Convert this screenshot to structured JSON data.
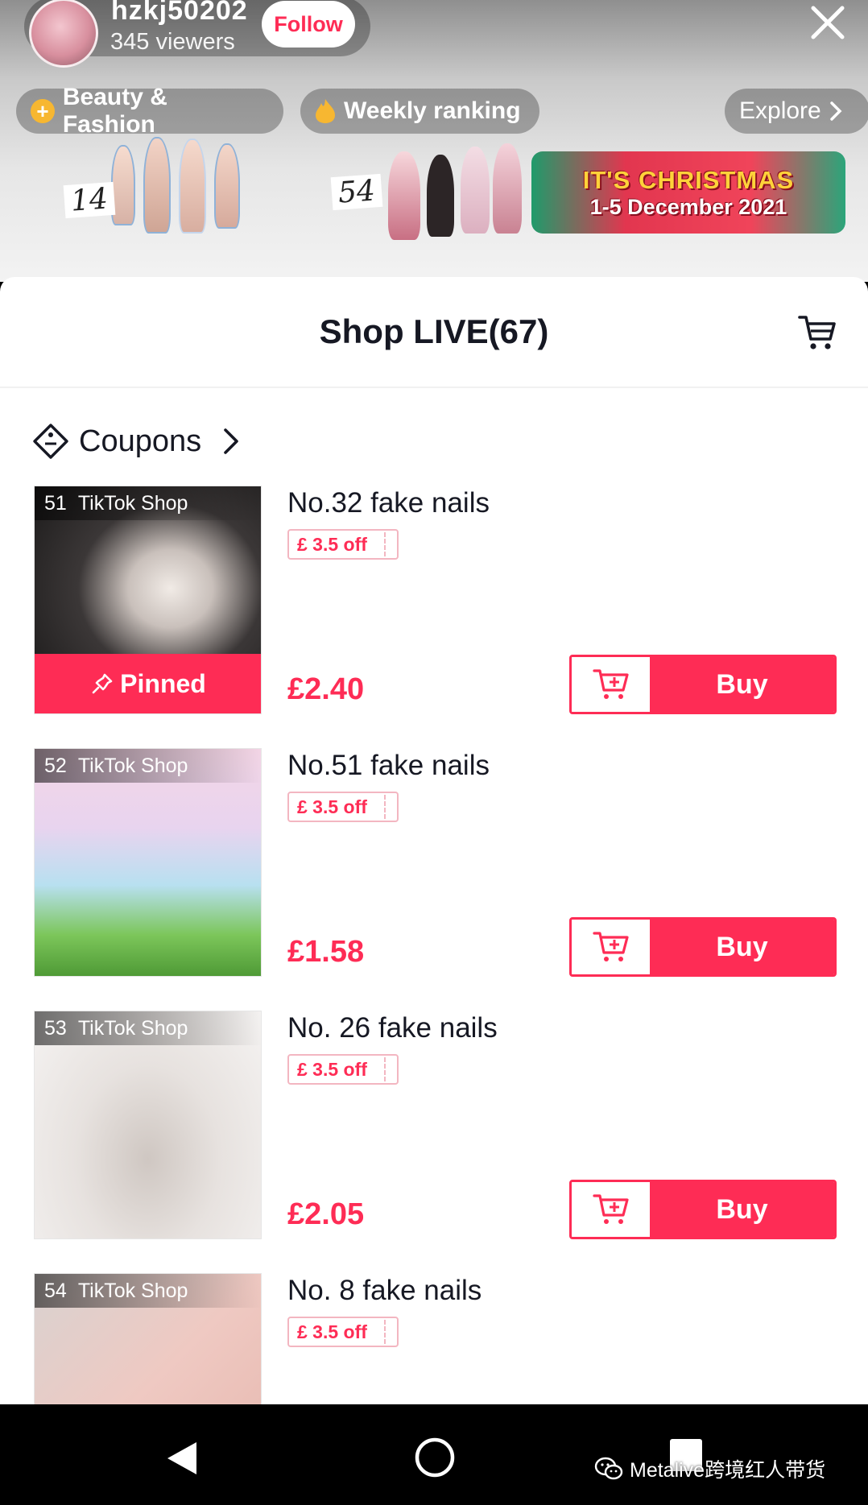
{
  "live": {
    "host_name": "hzkj50202",
    "viewers": "345 viewers",
    "follow_label": "Follow",
    "chips": [
      {
        "label": "Beauty & Fashion",
        "icon": "plus-circle-icon"
      },
      {
        "label": "Weekly ranking",
        "icon": "flame-icon"
      },
      {
        "label": "Explore",
        "icon": "chevron-right-icon"
      }
    ],
    "tags": [
      "14",
      "54"
    ],
    "promo": {
      "title": "IT'S CHRISTMAS",
      "dates": "1-5 December 2021"
    }
  },
  "shop": {
    "title": "Shop LIVE(67)",
    "coupons_label": "Coupons",
    "products": [
      {
        "index": "51",
        "shop": "TikTok Shop",
        "name": "No.32 fake nails",
        "coupon": "£ 3.5 off",
        "price": "£2.40",
        "pinned_label": "Pinned",
        "buy_label": "Buy"
      },
      {
        "index": "52",
        "shop": "TikTok Shop",
        "name": "No.51 fake nails",
        "coupon": "£ 3.5 off",
        "price": "£1.58",
        "buy_label": "Buy"
      },
      {
        "index": "53",
        "shop": "TikTok Shop",
        "name": "No. 26 fake nails",
        "coupon": "£ 3.5 off",
        "price": "£2.05",
        "buy_label": "Buy"
      },
      {
        "index": "54",
        "shop": "TikTok Shop",
        "name": "No. 8 fake nails",
        "coupon": "£ 3.5 off"
      }
    ]
  },
  "watermark": "Metalive跨境红人带货",
  "colors": {
    "accent": "#fe2c55",
    "text": "#161823",
    "chip_bg": "rgba(0,0,0,0.28)"
  }
}
